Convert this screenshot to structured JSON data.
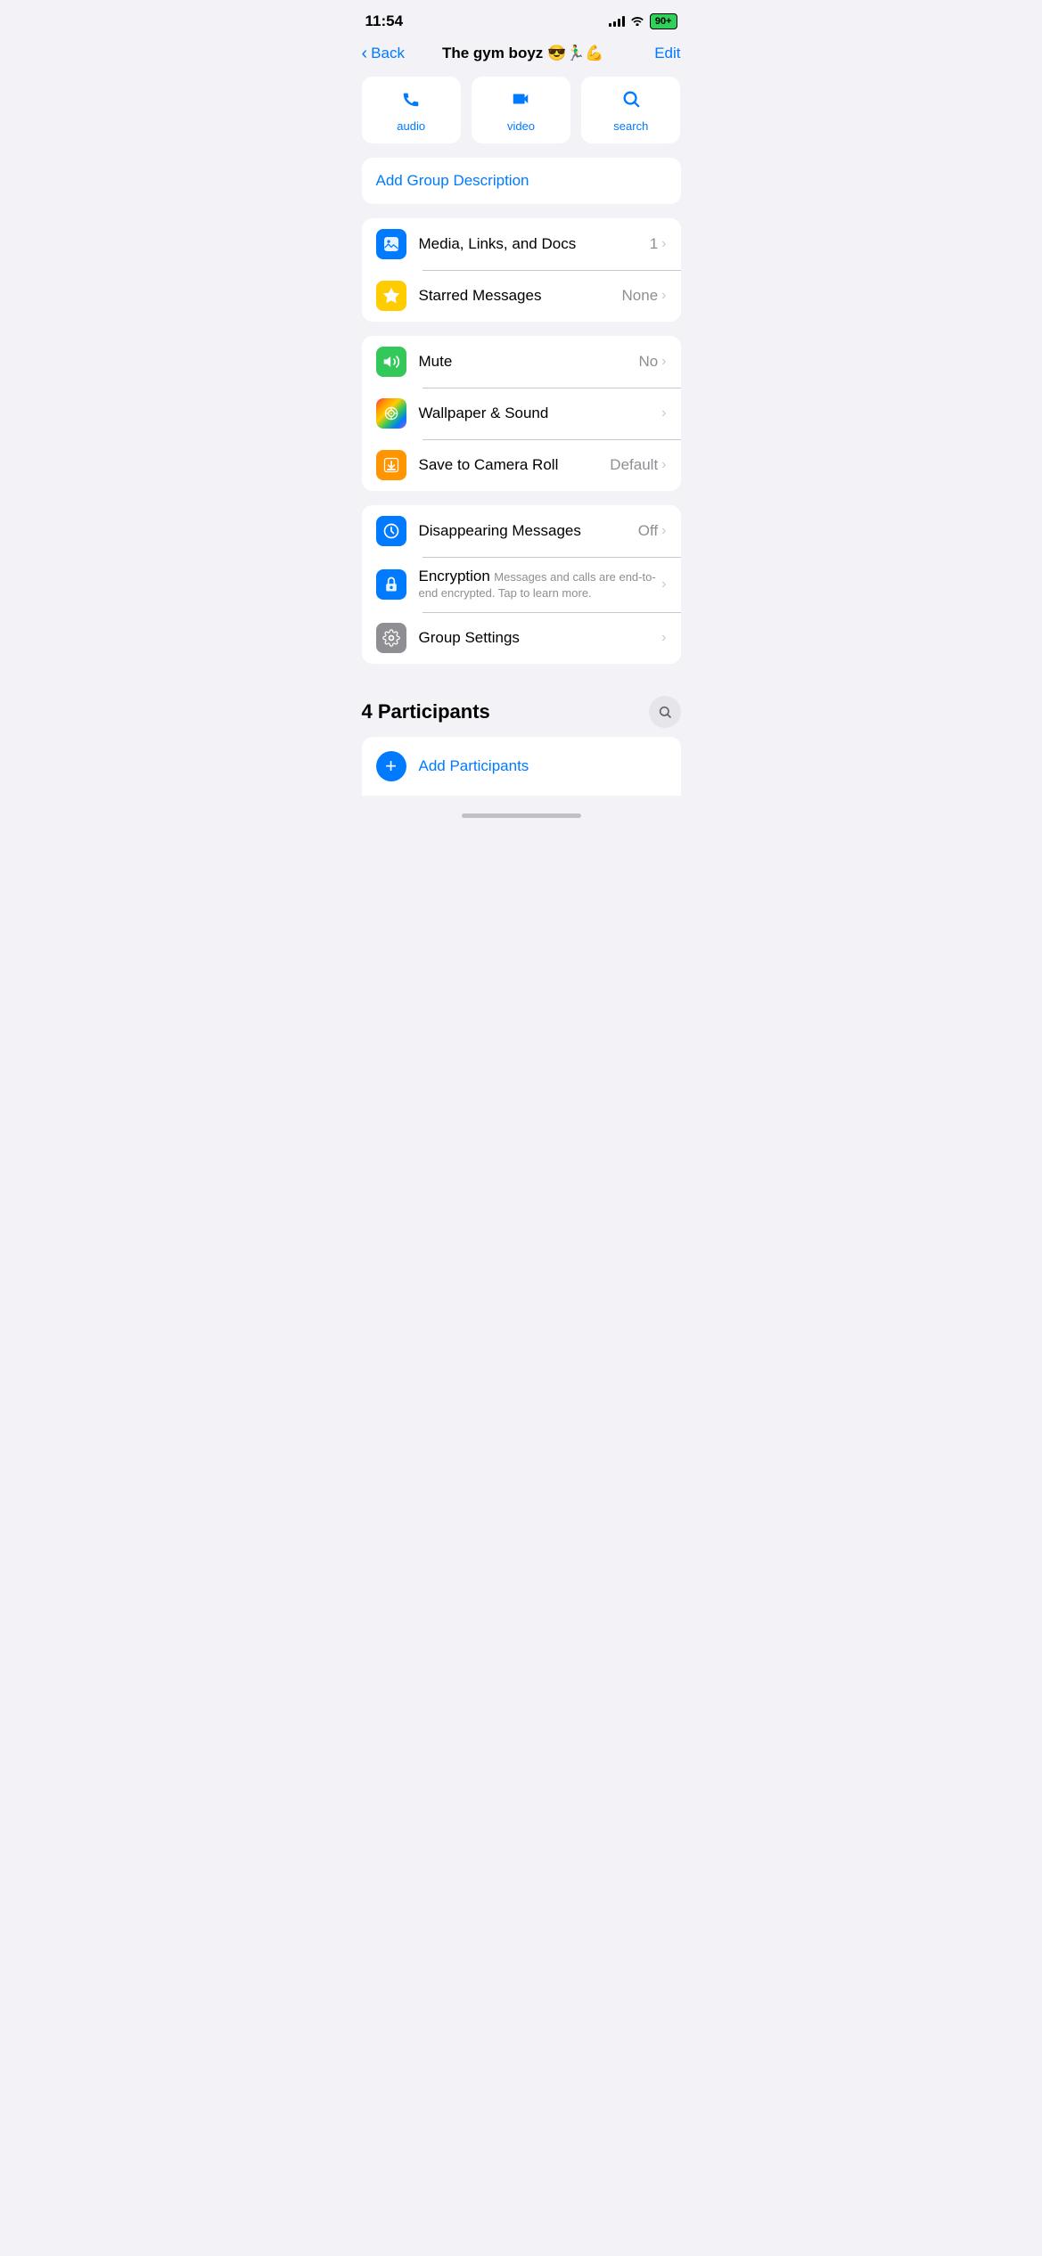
{
  "statusBar": {
    "time": "11:54",
    "battery": "90+"
  },
  "nav": {
    "back": "Back",
    "title": "The gym boyz 😎🏃‍♂️💪",
    "edit": "Edit"
  },
  "actions": [
    {
      "id": "audio",
      "label": "audio",
      "icon": "phone"
    },
    {
      "id": "video",
      "label": "video",
      "icon": "video"
    },
    {
      "id": "search",
      "label": "search",
      "icon": "search"
    }
  ],
  "addDescription": "Add Group Description",
  "mediaSection": [
    {
      "id": "media-links-docs",
      "label": "Media, Links, and Docs",
      "value": "1",
      "iconBg": "blue"
    },
    {
      "id": "starred-messages",
      "label": "Starred Messages",
      "value": "None",
      "iconBg": "yellow"
    }
  ],
  "settingsSection": [
    {
      "id": "mute",
      "label": "Mute",
      "value": "No",
      "iconBg": "green"
    },
    {
      "id": "wallpaper-sound",
      "label": "Wallpaper & Sound",
      "value": "",
      "iconBg": "pink"
    },
    {
      "id": "save-camera-roll",
      "label": "Save to Camera Roll",
      "value": "Default",
      "iconBg": "orange"
    }
  ],
  "advancedSection": [
    {
      "id": "disappearing-messages",
      "label": "Disappearing Messages",
      "value": "Off",
      "iconBg": "blue2",
      "subtitle": ""
    },
    {
      "id": "encryption",
      "label": "Encryption",
      "value": "",
      "iconBg": "blue2",
      "subtitle": "Messages and calls are end-to-end encrypted. Tap to learn more."
    },
    {
      "id": "group-settings",
      "label": "Group Settings",
      "value": "",
      "iconBg": "gray",
      "subtitle": ""
    }
  ],
  "participantsSection": {
    "title": "4 Participants"
  },
  "addParticipants": "Add Participants"
}
